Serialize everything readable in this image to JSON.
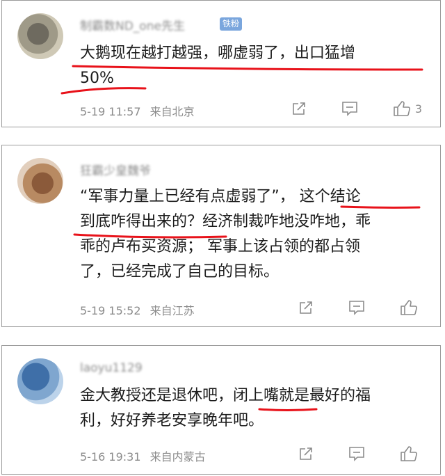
{
  "comments": [
    {
      "username": "制霸数ND_one先生",
      "badge": "铁粉",
      "lines": [
        "大鹅现在越打越强，哪虚弱了，出口猛增",
        "50%"
      ],
      "time": "5-19 11:57",
      "location": "来自北京",
      "likes": "3"
    },
    {
      "username": "狂霸少皇魏爷",
      "lines": [
        "“军事力量上已经有点虚弱了”， 这个结论",
        "到底咋得出来的？经济制裁咋地没咋地，乖",
        "乖的卢布买资源； 军事上该占领的都占领",
        "了，已经完成了自己的目标。"
      ],
      "time": "5-19 15:52",
      "location": "来自江苏",
      "likes": ""
    },
    {
      "username": "laoyu1129",
      "lines": [
        "金大教授还是退休吧，闭上嘴就是最好的福",
        "利，好好养老安享晚年吧。"
      ],
      "time": "5-16 19:31",
      "location": "来自内蒙古",
      "likes": ""
    }
  ],
  "icons": {
    "share": "share-icon",
    "reply": "comment-icon",
    "like": "thumbs-up-icon"
  },
  "colors": {
    "underline": "#e8121a",
    "meta": "#8c8c8c",
    "badge": "#7aa6dd"
  }
}
